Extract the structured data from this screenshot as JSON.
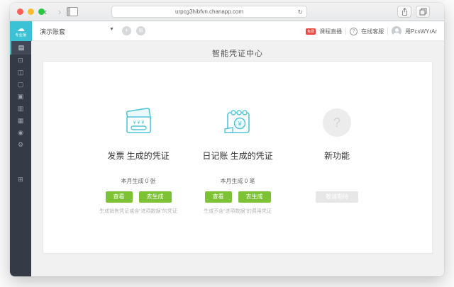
{
  "browser": {
    "url": "urpcg3hibfvn.chanapp.com",
    "reload_icon": "reload-icon",
    "traffic_colors": {
      "close": "#ff5f57",
      "minimize": "#febc2e",
      "zoom": "#28c840"
    }
  },
  "app_header": {
    "logo": {
      "icon": "cloud-icon",
      "glyph": "☁",
      "edition": "专业版",
      "color": "#3bc2d4"
    },
    "account_name": "演示账套",
    "caret": "▼",
    "plus_icon": "+",
    "grid_icon": "⊞",
    "right": {
      "live_badge": "免费",
      "live_label": "课程直播",
      "help_mark": "?",
      "support_label": "在线客服",
      "username": "用PcsWYrAr"
    }
  },
  "sidebar": {
    "background": "#343b46",
    "active_color": "#3bc2d4",
    "items": [
      {
        "name": "voucher-icon",
        "glyph": "▤"
      },
      {
        "name": "ledger-icon",
        "glyph": "⊡"
      },
      {
        "name": "report-chart-icon",
        "glyph": "◫"
      },
      {
        "name": "funds-icon",
        "glyph": "▢"
      },
      {
        "name": "invoice-icon",
        "glyph": "▣"
      },
      {
        "name": "salary-icon",
        "glyph": "▥"
      },
      {
        "name": "assets-icon",
        "glyph": "▦"
      },
      {
        "name": "checkout-icon",
        "glyph": "◉"
      },
      {
        "name": "settings-icon",
        "glyph": "⚙"
      },
      {
        "name": "store-icon",
        "glyph": "⊞"
      }
    ]
  },
  "page": {
    "title": "智能凭证中心",
    "accent_green": "#7cc234",
    "accent_cyan": "#53c6d8",
    "cards": [
      {
        "icon": "invoice-ticket-icon",
        "title": "发票 生成的凭证",
        "count_text": "本月生成 0 张",
        "view_label": "查看",
        "generate_label": "去生成",
        "caption": "生成销售凭证或含“进项数据”的凭证"
      },
      {
        "icon": "journal-calendar-icon",
        "title": "日记账 生成的凭证",
        "count_text": "本月生成 0 笔",
        "view_label": "查看",
        "generate_label": "去生成",
        "caption": "生成不含“进项数据”的费用凭证"
      },
      {
        "icon": "question-circle-icon",
        "question_mark": "?",
        "title": "新功能",
        "coming_label": "敬请期待"
      }
    ]
  }
}
